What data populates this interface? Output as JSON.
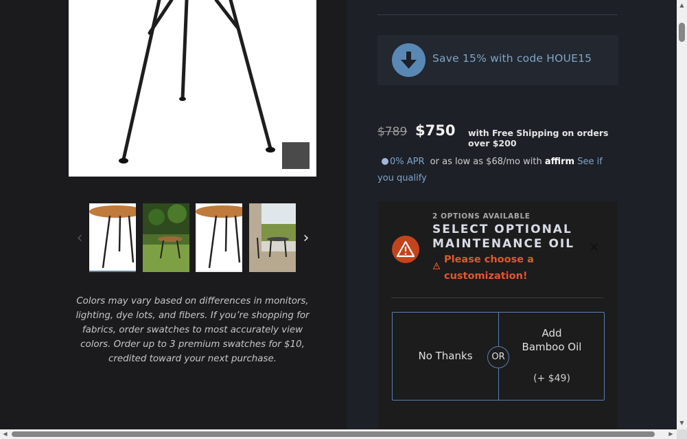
{
  "gallery": {
    "prev_icon": "chevron-left-icon",
    "next_icon": "chevron-right-icon",
    "thumbnails": [
      "thumbnail-table-white",
      "thumbnail-garden",
      "thumbnail-table-white-2",
      "thumbnail-patio"
    ],
    "disclaimer": "Colors may vary based on differences in monitors, lighting, dye lots, and fibers. If you’re shopping for fabrics, order swatches to most accurately view colors. Order up to 3 premium swatches for $10, credited toward your next purchase."
  },
  "promo": {
    "icon": "download-arrow-icon",
    "text": "Save 15% with code HOUE15"
  },
  "pricing": {
    "old_price": "$789",
    "new_price": "$750",
    "shipping": "with Free Shipping on orders over $200",
    "apr_badge": "0% APR",
    "financing": "or as low as $68/mo with",
    "affirm": "affirm",
    "qualify_link": "See if you qualify"
  },
  "options": {
    "count": "2 OPTIONS AVAILABLE",
    "title": "SELECT OPTIONAL MAINTENANCE OIL",
    "error": "Please choose a customization!",
    "close_icon": "close-icon",
    "no_thanks": "No Thanks",
    "or": "OR",
    "add_label": "Add Bamboo Oil",
    "add_price": "(+ $49)"
  },
  "colors": {
    "accent_blue": "#5a88b4",
    "link_blue": "#7fa6c9",
    "warning_red": "#c2441d",
    "error_text": "#e3582d"
  }
}
